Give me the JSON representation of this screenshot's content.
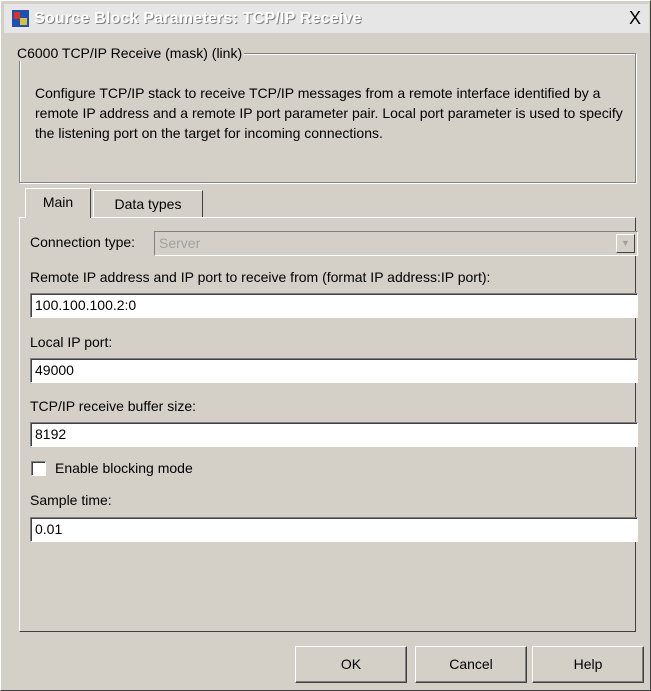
{
  "window": {
    "title": "Source Block Parameters: TCP/IP Receive",
    "close_label": "X"
  },
  "description": {
    "legend": "C6000 TCP/IP Receive (mask) (link)",
    "text": "Configure TCP/IP stack  to receive TCP/IP messages from a remote interface identified by a remote  IP address and a remote IP port parameter pair. Local port parameter is used to specify the listening port on the target for incoming connections."
  },
  "tabs": [
    {
      "label": "Main",
      "active": true
    },
    {
      "label": "Data types",
      "active": false
    }
  ],
  "form": {
    "connection_type_label": "Connection type:",
    "connection_type_value": "Server",
    "remote_label": "Remote IP address and IP port to receive from (format IP address:IP port):",
    "remote_value": "100.100.100.2:0",
    "local_port_label": "Local IP port:",
    "local_port_value": "49000",
    "buffer_label": "TCP/IP receive buffer size:",
    "buffer_value": "8192",
    "blocking_label": "Enable blocking mode",
    "blocking_checked": false,
    "sample_time_label": "Sample time:",
    "sample_time_value": "0.01"
  },
  "buttons": {
    "ok": "OK",
    "cancel": "Cancel",
    "help": "Help"
  }
}
